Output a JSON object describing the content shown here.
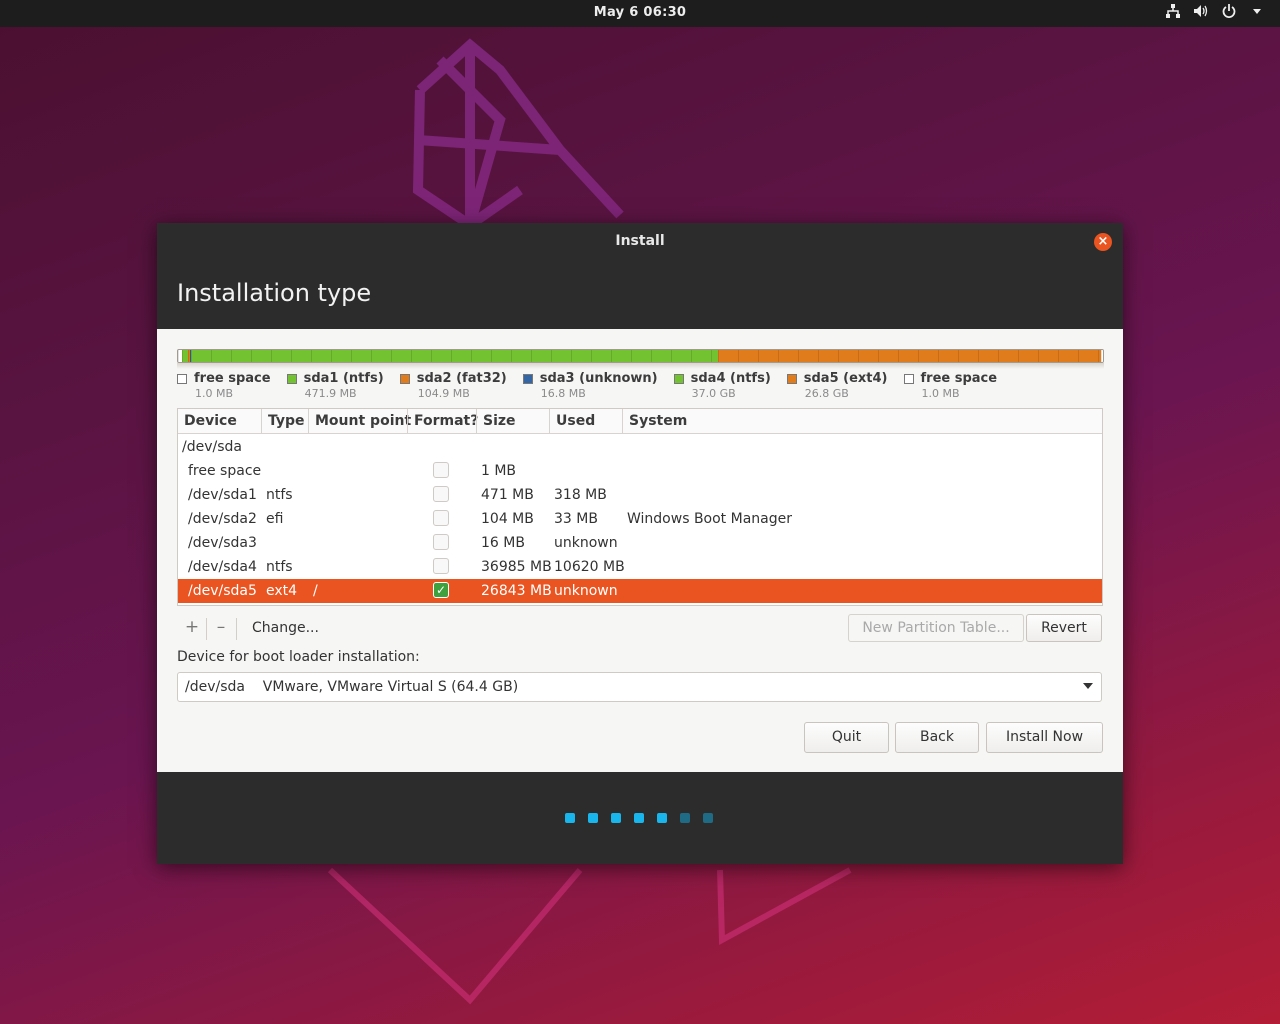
{
  "topbar": {
    "clock": "May 6  06:30",
    "icons": [
      "network-icon",
      "volume-icon",
      "power-icon",
      "menu-arrow-icon"
    ]
  },
  "window": {
    "title": "Install",
    "page_title": "Installation type"
  },
  "colors": {
    "accent": "#e95420",
    "ntfs_green": "#73c232",
    "fat_orange": "#e07c1b",
    "unknown_blue": "#3465a4",
    "dot_active": "#19b6ee",
    "dot_inactive": "#1f6a85"
  },
  "partition_legend": [
    {
      "label": "free space",
      "size": "1.0 MB",
      "color": "#ffffff"
    },
    {
      "label": "sda1 (ntfs)",
      "size": "471.9 MB",
      "color": "#73c232"
    },
    {
      "label": "sda2 (fat32)",
      "size": "104.9 MB",
      "color": "#e07c1b"
    },
    {
      "label": "sda3 (unknown)",
      "size": "16.8 MB",
      "color": "#3465a4"
    },
    {
      "label": "sda4 (ntfs)",
      "size": "37.0 GB",
      "color": "#73c232"
    },
    {
      "label": "sda5 (ext4)",
      "size": "26.8 GB",
      "color": "#e07c1b"
    },
    {
      "label": "free space",
      "size": "1.0 MB",
      "color": "#ffffff"
    }
  ],
  "table": {
    "headers": [
      "Device",
      "Type",
      "Mount point",
      "Format?",
      "Size",
      "Used",
      "System"
    ],
    "disk": "/dev/sda",
    "rows": [
      {
        "device": "free space",
        "type": "",
        "mount": "",
        "format": false,
        "size": "1 MB",
        "used": "",
        "system": ""
      },
      {
        "device": "/dev/sda1",
        "type": "ntfs",
        "mount": "",
        "format": false,
        "size": "471 MB",
        "used": "318 MB",
        "system": ""
      },
      {
        "device": "/dev/sda2",
        "type": "efi",
        "mount": "",
        "format": false,
        "size": "104 MB",
        "used": "33 MB",
        "system": "Windows Boot Manager"
      },
      {
        "device": "/dev/sda3",
        "type": "",
        "mount": "",
        "format": false,
        "size": "16 MB",
        "used": "unknown",
        "system": ""
      },
      {
        "device": "/dev/sda4",
        "type": "ntfs",
        "mount": "",
        "format": false,
        "size": "36985 MB",
        "used": "10620 MB",
        "system": ""
      },
      {
        "device": "/dev/sda5",
        "type": "ext4",
        "mount": "/",
        "format": true,
        "size": "26843 MB",
        "used": "unknown",
        "system": "",
        "selected": true
      }
    ]
  },
  "toolbar": {
    "add": "+",
    "remove": "–",
    "change": "Change...",
    "new_partition_table": "New Partition Table...",
    "revert": "Revert"
  },
  "bootloader": {
    "label": "Device for boot loader installation:",
    "value": "/dev/sda    VMware, VMware Virtual S (64.4 GB)"
  },
  "buttons": {
    "quit": "Quit",
    "back": "Back",
    "install_now": "Install Now"
  },
  "progress": {
    "total_steps": 7,
    "current_step": 5
  }
}
